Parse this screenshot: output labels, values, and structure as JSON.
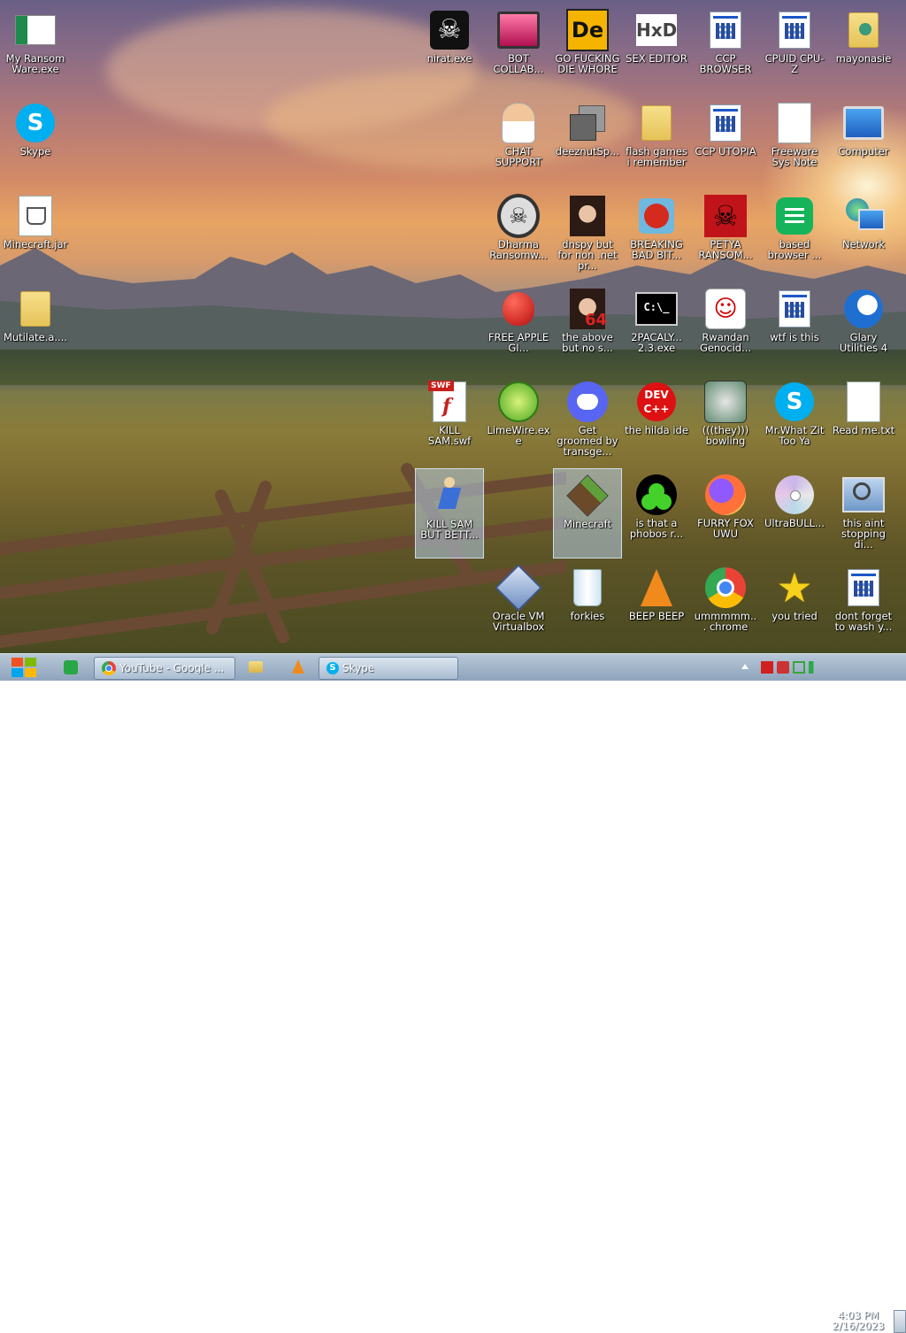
{
  "desktop": {
    "icons": [
      {
        "name": "my-ransomware-exe",
        "label": "My Ransom Ware.exe",
        "icon": "green-white-flag-icon"
      },
      {
        "name": "skype-shortcut",
        "label": "Skype",
        "icon": "skype-icon"
      },
      {
        "name": "minecraft-jar",
        "label": "Minecraft.jar",
        "icon": "java-file-icon"
      },
      {
        "name": "mutilate-folder",
        "label": "Mutilate.a....",
        "icon": "folder-icon"
      },
      {
        "name": "nirat-exe",
        "label": "nirat.exe",
        "icon": "skull-icon"
      },
      {
        "name": "bot-collab",
        "label": "BOT COLLAB...",
        "icon": "monitor-pink-icon"
      },
      {
        "name": "go-die",
        "label": "GO FUCKING DIE WHORE",
        "icon": "de-icon"
      },
      {
        "name": "sex-editor",
        "label": "SEX EDITOR",
        "icon": "hxd-icon"
      },
      {
        "name": "ccp-browser",
        "label": "CCP BROWSER",
        "icon": "app-window-icon"
      },
      {
        "name": "cpuid-cpuz",
        "label": "CPUID CPU-Z",
        "icon": "app-window-icon"
      },
      {
        "name": "mayonaise",
        "label": "mayonasie",
        "icon": "user-folder-icon"
      },
      {
        "name": "chat-support",
        "label": "CHAT SUPPORT",
        "icon": "doctor-icon"
      },
      {
        "name": "deeznutsp",
        "label": "deeznutSp...",
        "icon": "stacked-windows-icon"
      },
      {
        "name": "flash-games",
        "label": "flash games i remember",
        "icon": "folder-icon"
      },
      {
        "name": "ccp-utopia",
        "label": "CCP UTOPIA",
        "icon": "app-window-icon"
      },
      {
        "name": "freeware-sys-note",
        "label": "Freeware Sys Note",
        "icon": "blank-doc-icon"
      },
      {
        "name": "computer",
        "label": "Computer",
        "icon": "computer-icon"
      },
      {
        "name": "dharma-ransomware",
        "label": "Dharma Ransomw...",
        "icon": "skull-headphones-icon"
      },
      {
        "name": "dnspy",
        "label": "dnspy but for non .net pr...",
        "icon": "portrait-icon"
      },
      {
        "name": "breaking-bad-bit",
        "label": "BREAKING BAD BIT...",
        "icon": "angry-bird-icon"
      },
      {
        "name": "petya-ransom",
        "label": "PETYA RANSOM...",
        "icon": "red-skull-icon"
      },
      {
        "name": "based-browser",
        "label": "based browser ...",
        "icon": "green-chat-icon"
      },
      {
        "name": "network",
        "label": "Network",
        "icon": "network-globe-icon"
      },
      {
        "name": "free-apple",
        "label": "FREE APPLE GI...",
        "icon": "apple-icon"
      },
      {
        "name": "the-above",
        "label": "the above but no s...",
        "icon": "portrait-64-icon"
      },
      {
        "name": "2pacalypse",
        "label": "2PACALY... 2.3.exe",
        "icon": "terminal-icon"
      },
      {
        "name": "rwandan-genocide",
        "label": "Rwandan Genocid...",
        "icon": "meme-face-icon"
      },
      {
        "name": "wtf-is-this",
        "label": "wtf is this",
        "icon": "app-window-icon"
      },
      {
        "name": "glary-utilities",
        "label": "Glary Utilities 4",
        "icon": "glary-icon"
      },
      {
        "name": "kill-sam-swf",
        "label": "KILL SAM.swf",
        "icon": "flash-swf-icon"
      },
      {
        "name": "limewire",
        "label": "LimeWire.exe",
        "icon": "lime-icon"
      },
      {
        "name": "get-groomed",
        "label": "Get groomed by transge...",
        "icon": "discord-icon"
      },
      {
        "name": "the-hilda-ide",
        "label": "the hilda ide",
        "icon": "devcpp-icon"
      },
      {
        "name": "they-bowling",
        "label": "(((they))) bowling",
        "icon": "bowling-icon"
      },
      {
        "name": "mr-what-zit",
        "label": "Mr.What Zit Too Ya",
        "icon": "skype-icon"
      },
      {
        "name": "read-me-txt",
        "label": "Read me.txt",
        "icon": "text-file-icon"
      },
      {
        "name": "kill-sam-but-better",
        "label": "KILL SAM BUT BETT...",
        "icon": "figure-icon"
      },
      {
        "name": "minecraft",
        "label": "Minecraft",
        "icon": "grass-block-icon"
      },
      {
        "name": "phobos",
        "label": "is that a phobos r...",
        "icon": "green-dots-icon"
      },
      {
        "name": "furry-fox-uwu",
        "label": "FURRY FOX UWU",
        "icon": "firefox-icon"
      },
      {
        "name": "ultrabull",
        "label": "UltraBULL...",
        "icon": "cd-icon"
      },
      {
        "name": "this-aint-stopping",
        "label": "this aint stopping di...",
        "icon": "computer-search-icon"
      },
      {
        "name": "oracle-vm-virtualbox",
        "label": "Oracle VM Virtualbox",
        "icon": "virtualbox-icon"
      },
      {
        "name": "forkies",
        "label": "forkies",
        "icon": "recycle-bin-icon"
      },
      {
        "name": "beep-beep",
        "label": "BEEP BEEP",
        "icon": "vlc-icon"
      },
      {
        "name": "ummmm-chrome",
        "label": "ummmmm... chrome",
        "icon": "chrome-icon"
      },
      {
        "name": "you-tried",
        "label": "you tried",
        "icon": "star-icon"
      },
      {
        "name": "dont-forget",
        "label": "dont forget to wash y...",
        "icon": "app-window-icon"
      }
    ]
  },
  "taskbar": {
    "start_label": "",
    "windows": [
      {
        "label": "YouTube - Google ..."
      },
      {
        "label": "Skype"
      }
    ],
    "clock": {
      "time": "4:03 PM",
      "date": "2/16/2023"
    }
  },
  "colors": {
    "taskbar_top": "#b7c7d8",
    "taskbar_bottom": "#8ea4bc",
    "skype_blue": "#00aff0",
    "accent_green": "#2c9a4a"
  }
}
